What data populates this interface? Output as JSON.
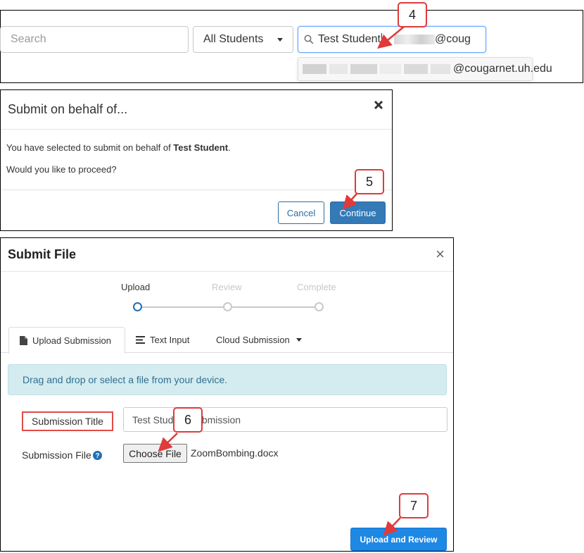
{
  "search_bar": {
    "search_placeholder": "Search",
    "students_filter": "All Students",
    "student_search_typed": "Test Student",
    "student_search_suffix": "@coug",
    "suggestion_suffix": "@cougarnet.uh.edu"
  },
  "confirm_dialog": {
    "title": "Submit on behalf of...",
    "message_prefix": "You have selected to submit on behalf of ",
    "student_name": "Test Student",
    "message_suffix": ".",
    "question": "Would you like to proceed?",
    "cancel_label": "Cancel",
    "continue_label": "Continue"
  },
  "submit_file": {
    "title": "Submit File",
    "steps": [
      {
        "label": "Upload",
        "state": "active"
      },
      {
        "label": "Review",
        "state": "inactive"
      },
      {
        "label": "Complete",
        "state": "inactive"
      }
    ],
    "tabs": [
      {
        "label": "Upload Submission",
        "icon": "file-icon",
        "active": true
      },
      {
        "label": "Text Input",
        "icon": "text-lines-icon",
        "active": false
      },
      {
        "label": "Cloud Submission",
        "icon": "caret-down-icon",
        "active": false
      }
    ],
    "info_message": "Drag and drop or select a file from your device.",
    "title_label": "Submission Title",
    "title_value": "Test Student Submission",
    "file_label": "Submission File",
    "choose_file_label": "Choose File",
    "file_name": "ZoomBombing.docx",
    "upload_button_label": "Upload and Review"
  },
  "callouts": [
    "4",
    "5",
    "6",
    "7"
  ],
  "colors": {
    "callout_border": "#e03a3a",
    "primary_button": "#337ab7",
    "upload_button": "#1e88e5",
    "info_background": "#d4ecf0",
    "step_active": "#1f6fb5",
    "step_inactive": "#c9c9c9"
  }
}
